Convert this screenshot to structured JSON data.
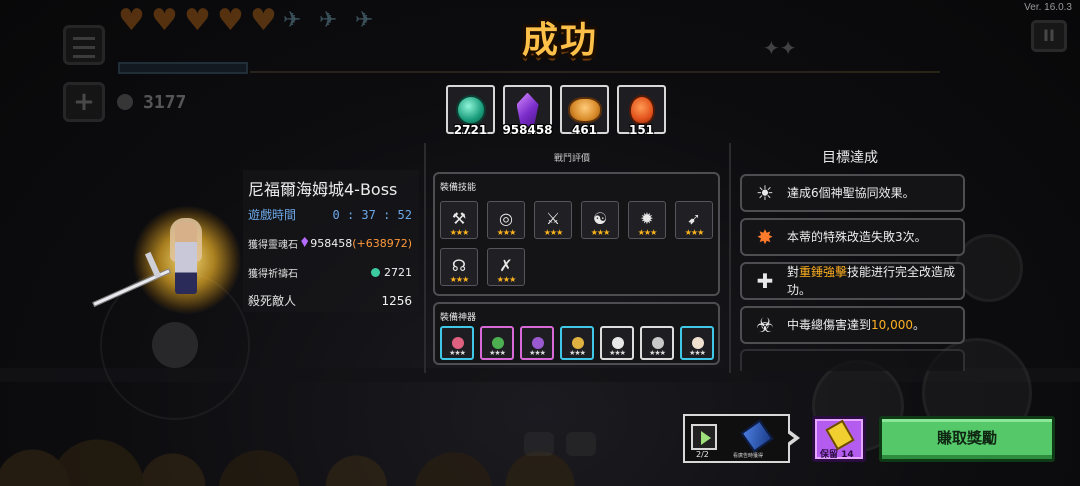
{
  "version": "Ver. 16.0.3",
  "title": "成功",
  "hud": {
    "coins": "3177"
  },
  "rewards": [
    {
      "icon": "teal-gem-icon",
      "count": "2721"
    },
    {
      "icon": "purple-crystal-icon",
      "count": "958458"
    },
    {
      "icon": "mooncake-icon",
      "count": "461"
    },
    {
      "icon": "lantern-icon",
      "count": "151"
    }
  ],
  "battle_title": "戰鬥評價",
  "stage": {
    "name": "尼福爾海姆城4-Boss",
    "time_label": "遊戲時間",
    "time_value": "0 : 37 : 52",
    "soul_label": "獲得靈魂石",
    "soul_value": "958458",
    "soul_gain": "(+638972)",
    "gem_label": "獲得祈禱石",
    "gem_value": "2721",
    "kills_label": "殺死敵人",
    "kills_value": "1256"
  },
  "skills_panel": {
    "label": "裝備技能",
    "skills": [
      {
        "icon": "hammer-strike-icon",
        "glyph": "⚒",
        "stars": "★★★"
      },
      {
        "icon": "target-orb-icon",
        "glyph": "◎",
        "stars": "★★★"
      },
      {
        "icon": "sword-dash-icon",
        "glyph": "⚔",
        "stars": "★★★"
      },
      {
        "icon": "whirlwind-icon",
        "glyph": "☯",
        "stars": "★★★"
      },
      {
        "icon": "spin-blade-icon",
        "glyph": "✹",
        "stars": "★★★"
      },
      {
        "icon": "charge-icon",
        "glyph": "➹",
        "stars": "★★★"
      },
      {
        "icon": "headphones-icon",
        "glyph": "☊",
        "stars": "★★★"
      },
      {
        "icon": "crossed-swords-icon",
        "glyph": "✗",
        "stars": "★★★"
      }
    ]
  },
  "artifacts_panel": {
    "label": "裝備神器",
    "artifacts": [
      {
        "icon": "red-egg-artifact-icon",
        "color": "#e06080",
        "border": "#3fc8e8",
        "stars": "★★★"
      },
      {
        "icon": "clover-artifact-icon",
        "color": "#4caf50",
        "border": "#d86ad8",
        "stars": "★★★"
      },
      {
        "icon": "purple-orb-artifact-icon",
        "color": "#9b59d0",
        "border": "#d86ad8",
        "stars": "★★★"
      },
      {
        "icon": "golden-bird-artifact-icon",
        "color": "#e0b040",
        "border": "#3fc8e8",
        "stars": "★★★"
      },
      {
        "icon": "pearl-string-artifact-icon",
        "color": "#e8e8e8",
        "border": "#dddddd",
        "stars": "★★★"
      },
      {
        "icon": "white-stone-artifact-icon",
        "color": "#c8c8c8",
        "border": "#dddddd",
        "stars": "★★★"
      },
      {
        "icon": "shell-artifact-icon",
        "color": "#f0e0d0",
        "border": "#3fc8e8",
        "stars": "★★★"
      }
    ]
  },
  "goals": {
    "title": "目標達成",
    "items": [
      {
        "icon": "holy-sun-icon",
        "glyph": "☀",
        "text": "達成6個神聖協同效果。",
        "highlight": ""
      },
      {
        "icon": "explosion-icon",
        "glyph": "✸",
        "text": "本蒂的特殊改造失敗3次。",
        "highlight": ""
      },
      {
        "icon": "hammer-cross-icon",
        "glyph": "✚",
        "text_before": "對",
        "highlight": "重錘強擊",
        "text_after": "技能进行完全改造成功。"
      },
      {
        "icon": "biohazard-icon",
        "glyph": "☣",
        "text_before": "中毒總傷害達到",
        "highlight": "10,000",
        "text_after": "。"
      }
    ]
  },
  "ad": {
    "count": "2/2",
    "caption": "看廣告時獲得"
  },
  "keep": {
    "label": "保留 14"
  },
  "earn_button": "賺取獎勵"
}
